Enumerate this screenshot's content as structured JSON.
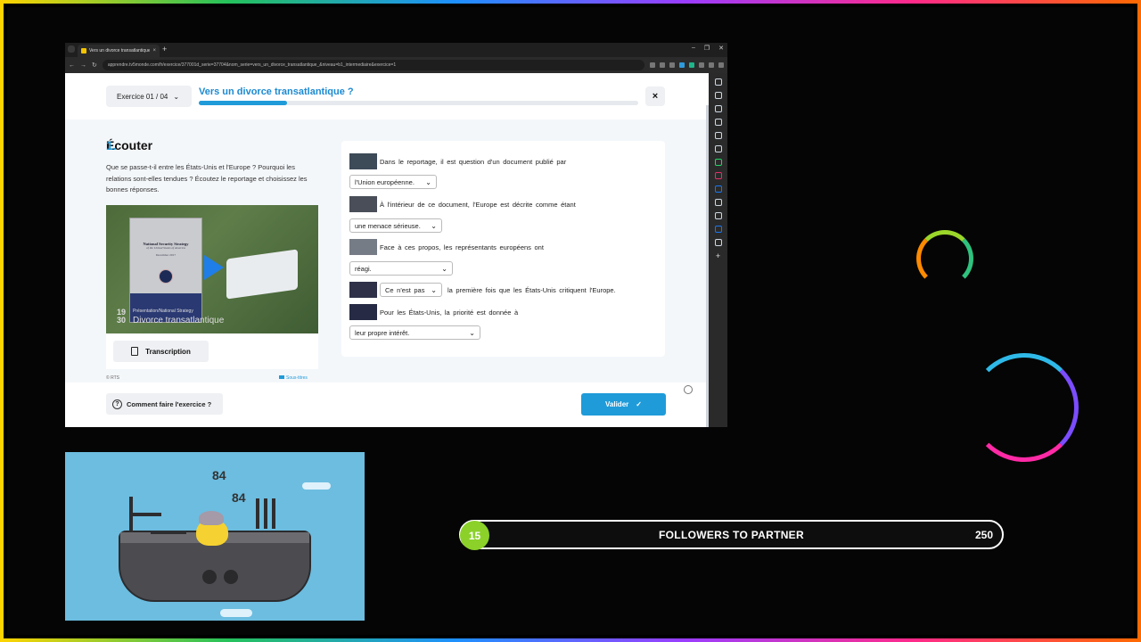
{
  "browser": {
    "tab_title": "Vers un divorce transatlantique",
    "url": "apprendre.tv5monde.com/fr/exercice/377001d_serie=37704&nom_serie=vers_un_divorce_transatlantique_&niveau=b1_intermediaire&exercice=1"
  },
  "exercise": {
    "selector_label": "Exercice 01 / 04",
    "title": "Vers un divorce transatlantique ?",
    "progress": 0.2,
    "close_label": "×",
    "section_number": "1.",
    "section_title": "Écouter",
    "instructions": "Que se passe-t-il entre les États-Unis et l'Europe ? Pourquoi les relations sont-elles tendues ? Écoutez le reportage et choisissez les bonnes réponses.",
    "video": {
      "book_title": "National Security Strategy",
      "book_subtitle": "of the United States of America",
      "book_date": "December 2017",
      "caption_small": "Présentation/National Strategy",
      "caption_big": "Divorce transatlantique",
      "timecode": "19 30"
    },
    "transcription_label": "Transcription",
    "credit": "© RTS",
    "subtitles_label": "Sous-titres",
    "questions": [
      {
        "text": "Dans le reportage, il est question d'un document publié par",
        "answer": "l'Union européenne."
      },
      {
        "text": "À l'intérieur de ce document, l'Europe est décrite comme étant",
        "answer": "une menace sérieuse."
      },
      {
        "text": "Face à ces propos, les représentants européens ont",
        "answer": "réagi."
      },
      {
        "text_after": "la première fois que les États-Unis critiquent l'Europe.",
        "answer": "Ce n'est pas"
      },
      {
        "text": "Pour les États-Unis, la priorité est donnée à",
        "answer": "leur propre intérêt."
      }
    ],
    "help_label": "Comment faire l'exercice ?",
    "validate_label": "Valider"
  },
  "game": {
    "score_1": "84",
    "score_2": "84"
  },
  "followers": {
    "current": "15",
    "label": "FOLLOWERS TO PARTNER",
    "goal": "250"
  },
  "colors": {
    "accent": "#1f9bd9",
    "follower_badge": "#8bd12a",
    "game_sky": "#6cbde0"
  }
}
